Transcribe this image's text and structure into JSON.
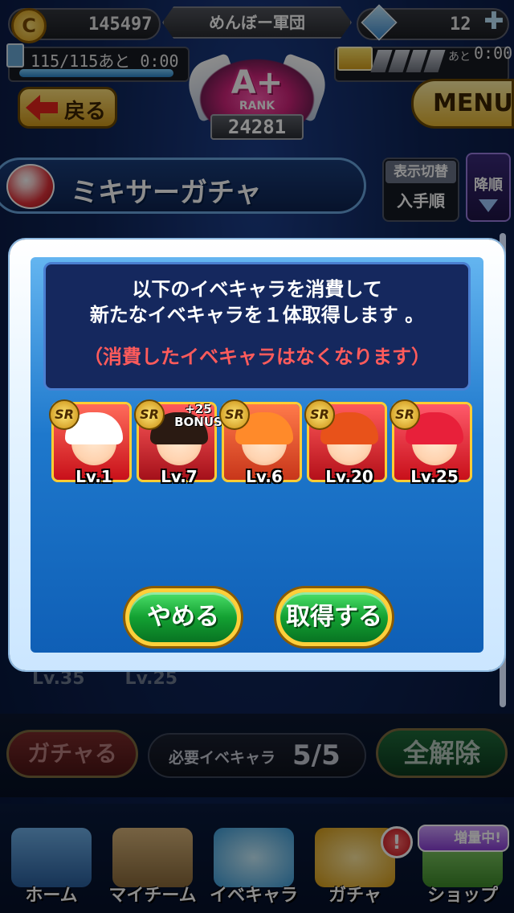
{
  "header": {
    "coins": "145497",
    "coin_icon_glyph": "C",
    "team_name": "めんぼー軍団",
    "gems": "12",
    "stamina": "115/115あと 0:00",
    "stamina_level": 1.0,
    "ticket_label": "あと",
    "ticket_time": "0:00",
    "rank_grade": "A+",
    "rank_label": "RANK",
    "rank_value": "24281",
    "back_label": "戻る",
    "menu_label": "MENU"
  },
  "gacha": {
    "title": "ミキサーガチャ",
    "sort_toggle_label": "表示切替",
    "sort_toggle_value": "入手順",
    "sort_order_label": "降順"
  },
  "background": {
    "levels": [
      "Lv.35",
      "Lv.25"
    ],
    "gacha_button": "ガチャる",
    "required_label": "必要イベキャラ",
    "required_value": "5/5",
    "clear_button": "全解除"
  },
  "dialog": {
    "line1": "以下のイベキャラを消費して",
    "line2": "新たなイベキャラを１体取得します 。",
    "warning": "（消費したイベキャラはなくなります）",
    "characters": [
      {
        "rarity": "SR",
        "level": "Lv.1",
        "bonus": ""
      },
      {
        "rarity": "SR",
        "level": "Lv.7",
        "bonus": "+25 BONUS"
      },
      {
        "rarity": "SR",
        "level": "Lv.6",
        "bonus": ""
      },
      {
        "rarity": "SR",
        "level": "Lv.20",
        "bonus": ""
      },
      {
        "rarity": "SR",
        "level": "Lv.25",
        "bonus": ""
      }
    ],
    "cancel_label": "やめる",
    "confirm_label": "取得する"
  },
  "nav": {
    "items": [
      "ホーム",
      "マイチーム",
      "イベキャラ",
      "ガチャ",
      "ショップ"
    ],
    "notify_badge": "!",
    "shop_badge": "増量中!"
  },
  "colors": {
    "confirm_green": "#13a132",
    "warning_red": "#ff5b5b",
    "gold_border": "#ffcf3a",
    "message_bg": "#15285e"
  }
}
